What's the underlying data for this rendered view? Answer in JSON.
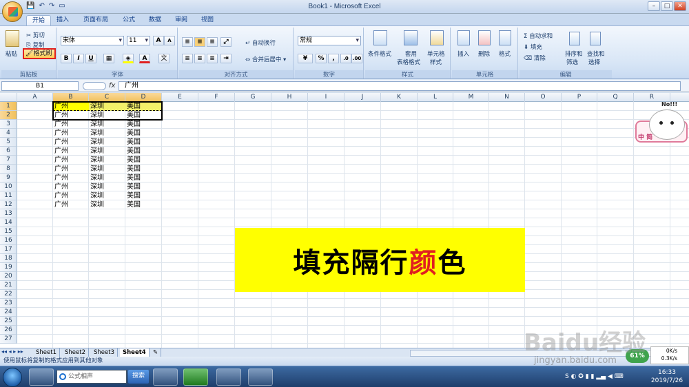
{
  "window": {
    "title": "Book1 - Microsoft Excel"
  },
  "tabs": [
    "开始",
    "插入",
    "页面布局",
    "公式",
    "数据",
    "审阅",
    "视图"
  ],
  "ribbon": {
    "clipboard": {
      "paste": "粘贴",
      "cut": "剪切",
      "copy": "复制",
      "format_painter": "格式刷",
      "label": "剪贴板"
    },
    "font": {
      "name": "宋体",
      "size": "11",
      "bold": "B",
      "italic": "I",
      "underline": "U",
      "grow": "A",
      "shrink": "A",
      "label": "字体"
    },
    "alignment": {
      "wrap": "自动换行",
      "merge": "合并后居中",
      "label": "对齐方式"
    },
    "number": {
      "format": "常规",
      "percent": "%",
      "comma": ",",
      "label": "数字"
    },
    "styles": {
      "conditional": "条件格式",
      "table_line1": "套用",
      "table_line2": "表格格式",
      "cell_line1": "单元格",
      "cell_line2": "样式",
      "label": "样式"
    },
    "cells": {
      "insert": "插入",
      "delete": "删除",
      "format": "格式",
      "label": "单元格"
    },
    "editing": {
      "autosum": "Σ 自动求和",
      "fill": "填充",
      "clear": "清除",
      "sort_line1": "排序和",
      "sort_line2": "筛选",
      "find_line1": "查找和",
      "find_line2": "选择",
      "label": "编辑"
    }
  },
  "formula_bar": {
    "name_box": "B1",
    "fx": "fx",
    "content": "广州"
  },
  "columns": [
    "A",
    "B",
    "C",
    "D",
    "E",
    "F",
    "G",
    "H",
    "I",
    "J",
    "K",
    "L",
    "M",
    "N",
    "O",
    "P",
    "Q",
    "R"
  ],
  "rows": [
    "1",
    "2",
    "3",
    "4",
    "5",
    "6",
    "7",
    "8",
    "9",
    "10",
    "11",
    "12",
    "13",
    "14",
    "15",
    "16",
    "17",
    "18",
    "19",
    "20",
    "21",
    "22",
    "23",
    "24",
    "25",
    "26",
    "27"
  ],
  "cells": {
    "B": "广州",
    "C": "深圳",
    "D": "美国"
  },
  "banner": {
    "part1": "填充隔行",
    "highlight": "颜",
    "part2": "色"
  },
  "mascot": {
    "text": "No!!!",
    "badge": "中 简"
  },
  "sheets": [
    "Sheet1",
    "Sheet2",
    "Sheet3",
    "Sheet4"
  ],
  "status": "使用鼠标将复制的格式应用到其他对象",
  "taskbar": {
    "search_placeholder": "公式相声",
    "search_btn": "搜索",
    "time": "16:33",
    "date": "2019/7/26"
  },
  "net": {
    "percent": "61%",
    "up": "0K/s",
    "down": "0.3K/s"
  },
  "watermark": {
    "main": "Baidu经验",
    "url": "jingyan.baidu.com"
  },
  "colors": {
    "highlight_yellow": "#ffff00",
    "accent_red": "#e02020"
  }
}
